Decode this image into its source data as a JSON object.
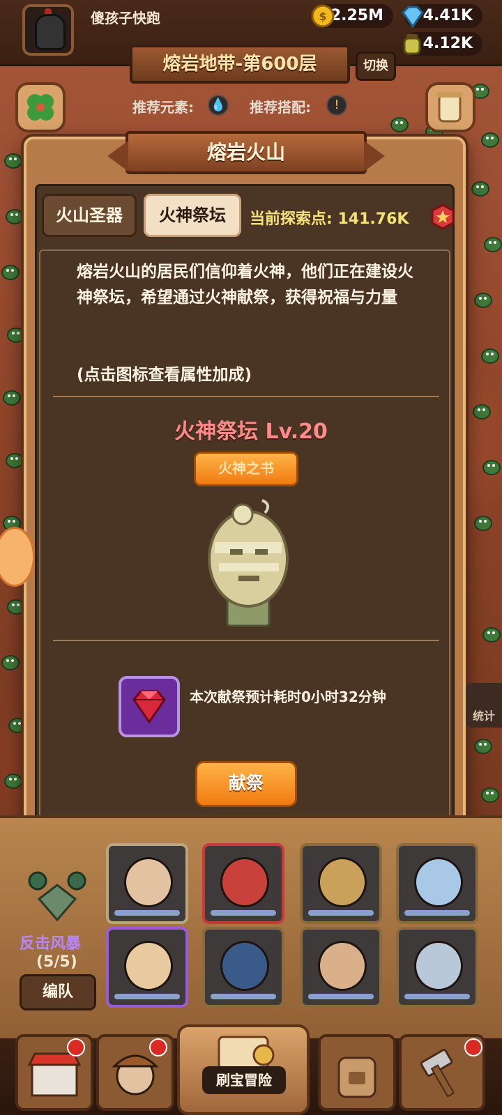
{
  "player": {
    "name": "傻孩子快跑",
    "gold": "2.25M",
    "diamonds": "4.41K",
    "potions": "4.12K"
  },
  "stage": {
    "title": "熔岩地带-第600层",
    "switch_label": "切换",
    "recommend_element_label": "推荐元素:",
    "recommend_combo_label": "推荐搭配:"
  },
  "dialog": {
    "title": "熔岩火山",
    "tabs": [
      {
        "label": "火山圣器",
        "active": false
      },
      {
        "label": "火神祭坛",
        "active": true
      }
    ],
    "explore_label": "当前探索点:",
    "explore_value": "141.76K",
    "description": "熔岩火山的居民们信仰着火神，他们正在建设火神祭坛，希望通过火神献祭，获得祝福与力量",
    "hint": "(点击图标查看属性加成)",
    "altar_title": "火神祭坛 Lv.20",
    "book_button": "火神之书",
    "offer_time_text": "本次献祭预计耗时0小时32分钟",
    "offer_button": "献祭"
  },
  "team": {
    "combo_name": "反击风暴",
    "combo_count": "(5/5)",
    "formation_button": "编队"
  },
  "nav": {
    "center_label": "刷宝冒险"
  },
  "side": {
    "stats_label": "统计"
  },
  "colors": {
    "accent_orange": "#f07b12",
    "altar_title": "#ff8a8a",
    "explore_yellow": "#f5e37a",
    "combo_purple": "#b588ff"
  }
}
